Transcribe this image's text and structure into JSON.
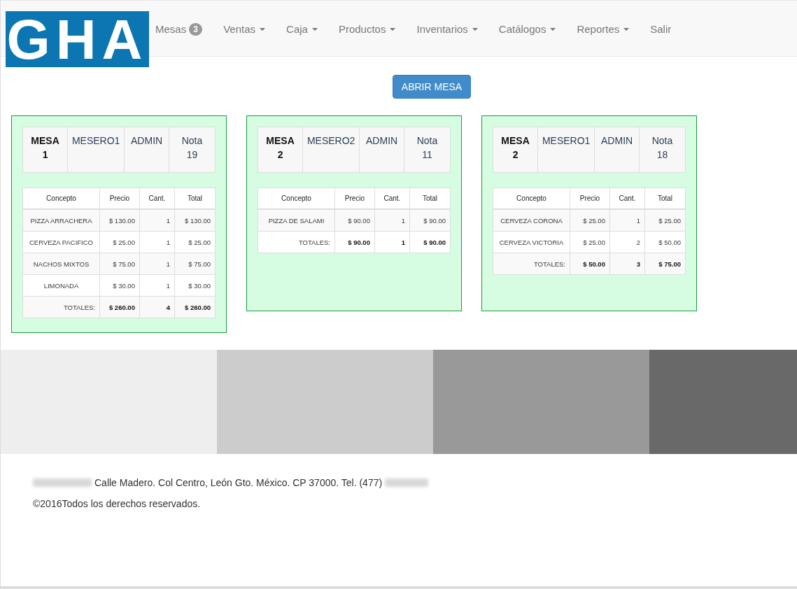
{
  "logo": {
    "text": "GHA"
  },
  "nav": [
    {
      "label": "Mesas",
      "kind": "badge",
      "badge": "3"
    },
    {
      "label": "Ventas",
      "kind": "dropdown"
    },
    {
      "label": "Caja",
      "kind": "dropdown"
    },
    {
      "label": "Productos",
      "kind": "dropdown"
    },
    {
      "label": "Inventarios",
      "kind": "dropdown"
    },
    {
      "label": "Catálogos",
      "kind": "dropdown"
    },
    {
      "label": "Reportes",
      "kind": "dropdown"
    },
    {
      "label": "Salir",
      "kind": "link"
    }
  ],
  "open_button": "ABRIR MESA",
  "tables": [
    {
      "mesa_label": "MESA",
      "mesa_number": "1",
      "waiter": "MESERO1",
      "user": "ADMIN",
      "nota_label": "Nota",
      "nota_number": "19",
      "columns": [
        "Concepto",
        "Precio",
        "Cant.",
        "Total"
      ],
      "rows": [
        {
          "concept": "PIZZA ARRACHERA",
          "price": "$ 130.00",
          "qty": "1",
          "total": "$ 130.00"
        },
        {
          "concept": "CERVEZA PACIFICO",
          "price": "$ 25.00",
          "qty": "1",
          "total": "$ 25.00"
        },
        {
          "concept": "NACHOS MIXTOS",
          "price": "$ 75.00",
          "qty": "1",
          "total": "$ 75.00"
        },
        {
          "concept": "LIMONADA",
          "price": "$ 30.00",
          "qty": "1",
          "total": "$ 30.00"
        }
      ],
      "totals": {
        "label": "TOTALES:",
        "price": "$ 260.00",
        "qty": "4",
        "total": "$ 260.00"
      }
    },
    {
      "mesa_label": "MESA",
      "mesa_number": "2",
      "waiter": "MESERO2",
      "user": "ADMIN",
      "nota_label": "Nota",
      "nota_number": "11",
      "columns": [
        "Concepto",
        "Precio",
        "Cant.",
        "Total"
      ],
      "rows": [
        {
          "concept": "PIZZA DE SALAMI",
          "price": "$ 90.00",
          "qty": "1",
          "total": "$ 90.00"
        }
      ],
      "totals": {
        "label": "TOTALES:",
        "price": "$ 90.00",
        "qty": "1",
        "total": "$ 90.00"
      }
    },
    {
      "mesa_label": "MESA",
      "mesa_number": "2",
      "waiter": "MESERO1",
      "user": "ADMIN",
      "nota_label": "Nota",
      "nota_number": "18",
      "columns": [
        "Concepto",
        "Precio",
        "Cant.",
        "Total"
      ],
      "rows": [
        {
          "concept": "CERVEZA CORONA",
          "price": "$ 25.00",
          "qty": "1",
          "total": "$ 25.00"
        },
        {
          "concept": "CERVEZA VICTORIA",
          "price": "$ 25.00",
          "qty": "2",
          "total": "$ 50.00"
        }
      ],
      "totals": {
        "label": "TOTALES:",
        "price": "$ 50.00",
        "qty": "3",
        "total": "$ 75.00"
      }
    }
  ],
  "color_bands": [
    {
      "color": "#eeeeee"
    },
    {
      "color": "#cccccc"
    },
    {
      "color": "#999999"
    },
    {
      "color": "#696969"
    }
  ],
  "footer": {
    "address": "Calle Madero. Col Centro, León Gto. México. CP 37000. Tel. (477)",
    "copyright": "©2016Todos los derechos reservados."
  }
}
